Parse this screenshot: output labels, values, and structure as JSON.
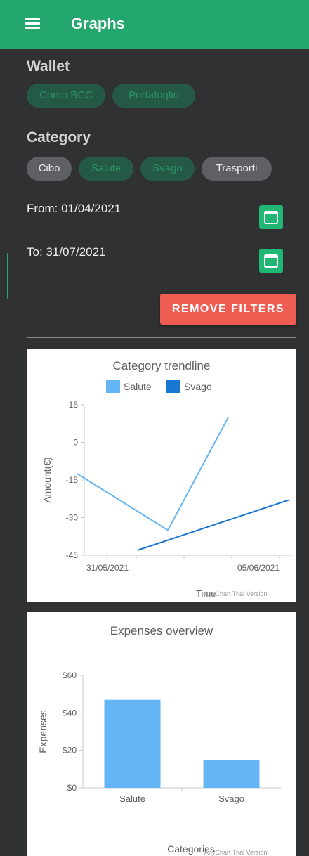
{
  "header": {
    "title": "Graphs",
    "menu_icon": "hamburger-menu-icon"
  },
  "wallet": {
    "title": "Wallet",
    "chips": [
      {
        "label": "Conto BCC",
        "selected": true
      },
      {
        "label": "Portafoglio",
        "selected": true
      }
    ]
  },
  "category": {
    "title": "Category",
    "chips": [
      {
        "label": "Cibo",
        "selected": false
      },
      {
        "label": "Salute",
        "selected": true
      },
      {
        "label": "Svago",
        "selected": true
      },
      {
        "label": "Trasporti",
        "selected": false
      }
    ]
  },
  "dates": {
    "from_label": "From: 01/04/2021",
    "to_label": "To: 31/07/2021",
    "calendar_icon": "calendar-icon"
  },
  "filters": {
    "remove_label": "REMOVE FILTERS"
  },
  "colors": {
    "appbar": "#24a76f",
    "background": "#303133",
    "selected_chip_bg": "#245a45",
    "selected_chip_text": "#2a9364",
    "unselected_chip_bg": "#5e6063",
    "remove_button": "#ef5c52",
    "calendar_button": "#21b674",
    "series_salute": "#64b5f6",
    "series_svago": "#1976d2"
  },
  "chart_data": [
    {
      "type": "line",
      "title": "Category trendline",
      "xlabel": "Time",
      "ylabel": "Amount(€)",
      "x_tick_labels": [
        "31/05/2021",
        "05/06/2021"
      ],
      "y_ticks": [
        15,
        0,
        -15,
        -30,
        -45
      ],
      "ylim": [
        -45,
        15
      ],
      "legend": "top",
      "series": [
        {
          "name": "Salute",
          "color": "#64b5f6",
          "x": [
            "30/05/2021",
            "02/06/2021",
            "04/06/2021"
          ],
          "values": [
            -12.5,
            -35,
            10
          ]
        },
        {
          "name": "Svago",
          "color": "#1976d2",
          "x": [
            "01/06/2021",
            "06/06/2021"
          ],
          "values": [
            -43,
            -23
          ]
        }
      ],
      "watermark": "AnyChart Trial Version"
    },
    {
      "type": "bar",
      "title": "Expenses overview",
      "xlabel": "Categories",
      "ylabel": "Expenses",
      "categories": [
        "Salute",
        "Svago"
      ],
      "values": [
        47,
        15
      ],
      "y_ticks": [
        "$0",
        "$20",
        "$40",
        "$60"
      ],
      "y_tick_values": [
        0,
        20,
        40,
        60
      ],
      "ylim": [
        0,
        60
      ],
      "color": "#64b5f6",
      "watermark": "AnyChart Trial Version"
    }
  ]
}
